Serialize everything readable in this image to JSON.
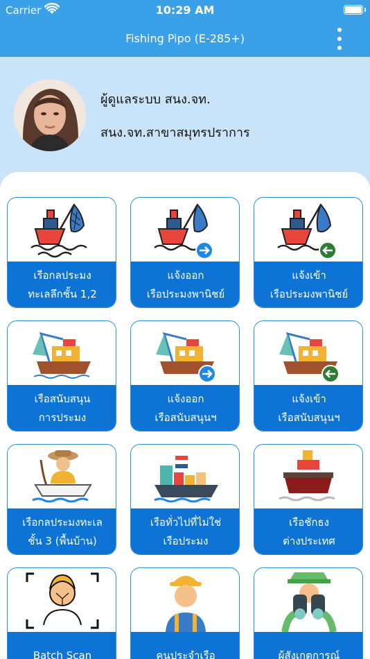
{
  "status_bar": {
    "carrier": "Carrier",
    "time": "10:29 AM"
  },
  "nav": {
    "title": "Fishing Pipo (E-285+)"
  },
  "profile": {
    "name": "ผู้ดูแลระบบ สนง.จท.",
    "branch": "สนง.จท.สาขาสมุทรปราการ"
  },
  "menu": [
    {
      "line1": "เรือกลประมง",
      "line2": "ทะเลลึกชั้น 1,2",
      "icon": "fishing-boat-icon"
    },
    {
      "line1": "แจ้งออก",
      "line2": "เรือประมงพานิชย์",
      "icon": "fishing-boat-depart-icon"
    },
    {
      "line1": "แจ้งเข้า",
      "line2": "เรือประมงพานิชย์",
      "icon": "fishing-boat-arrive-icon"
    },
    {
      "line1": "เรือสนับสนุน",
      "line2": "การประมง",
      "icon": "support-boat-icon"
    },
    {
      "line1": "แจ้งออก",
      "line2": "เรือสนับสนุนฯ",
      "icon": "support-boat-depart-icon"
    },
    {
      "line1": "แจ้งเข้า",
      "line2": "เรือสนับสนุนฯ",
      "icon": "support-boat-arrive-icon"
    },
    {
      "line1": "เรือกลประมงทะเล",
      "line2": "ชั้น 3 (พื้นบ้าน)",
      "icon": "local-fisherman-icon"
    },
    {
      "line1": "เรือทั่วไปที่ไม่ใช่",
      "line2": "เรือประมง",
      "icon": "cargo-ship-icon"
    },
    {
      "line1": "เรือชักธง",
      "line2": "ต่างประเทศ",
      "icon": "foreign-ship-icon"
    },
    {
      "line1": "Batch Scan",
      "line2": "",
      "icon": "face-scan-icon"
    },
    {
      "line1": "คนประจำเรือ",
      "line2": "",
      "icon": "crew-worker-icon"
    },
    {
      "line1": "ผู้สังเกตการณ์",
      "line2": "",
      "icon": "observer-binoculars-icon"
    }
  ]
}
